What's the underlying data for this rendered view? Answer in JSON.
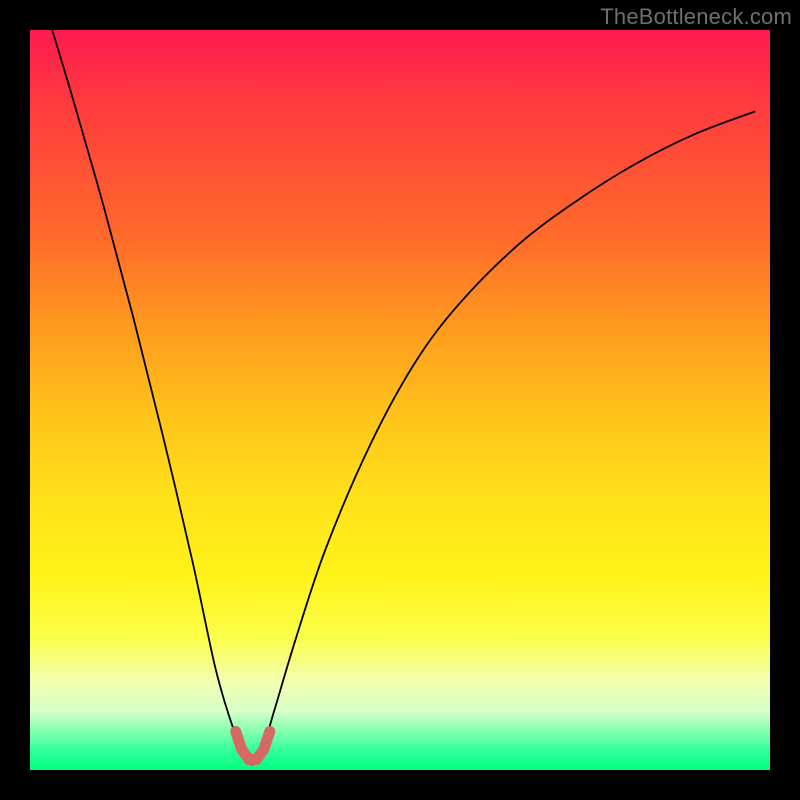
{
  "watermark": "TheBottleneck.com",
  "chart_data": {
    "type": "line",
    "title": "",
    "xlabel": "",
    "ylabel": "",
    "xlim": [
      0,
      100
    ],
    "ylim": [
      0,
      100
    ],
    "series": [
      {
        "name": "bottleneck-curve",
        "x": [
          3,
          6,
          10,
          14,
          18,
          22,
          25,
          27,
          28.5,
          29.5,
          30.5,
          31.5,
          33,
          36,
          40,
          46,
          52,
          58,
          66,
          74,
          82,
          90,
          98
        ],
        "y": [
          100,
          90,
          76,
          61,
          45,
          28,
          14,
          7,
          3,
          1,
          1,
          3,
          8,
          18,
          30,
          44,
          55,
          63,
          71,
          77,
          82,
          86,
          89
        ]
      }
    ],
    "marker": {
      "name": "optimal-region",
      "points": [
        {
          "x": 27.8,
          "y": 5.2
        },
        {
          "x": 28.6,
          "y": 2.8
        },
        {
          "x": 29.6,
          "y": 1.4
        },
        {
          "x": 30.6,
          "y": 1.4
        },
        {
          "x": 31.6,
          "y": 2.8
        },
        {
          "x": 32.4,
          "y": 5.2
        }
      ]
    },
    "gradient_stops": [
      {
        "pos": 0,
        "color": "#ff1a4d"
      },
      {
        "pos": 50,
        "color": "#ffcc1a"
      },
      {
        "pos": 85,
        "color": "#f8ff7a"
      },
      {
        "pos": 100,
        "color": "#00ff7f"
      }
    ]
  }
}
